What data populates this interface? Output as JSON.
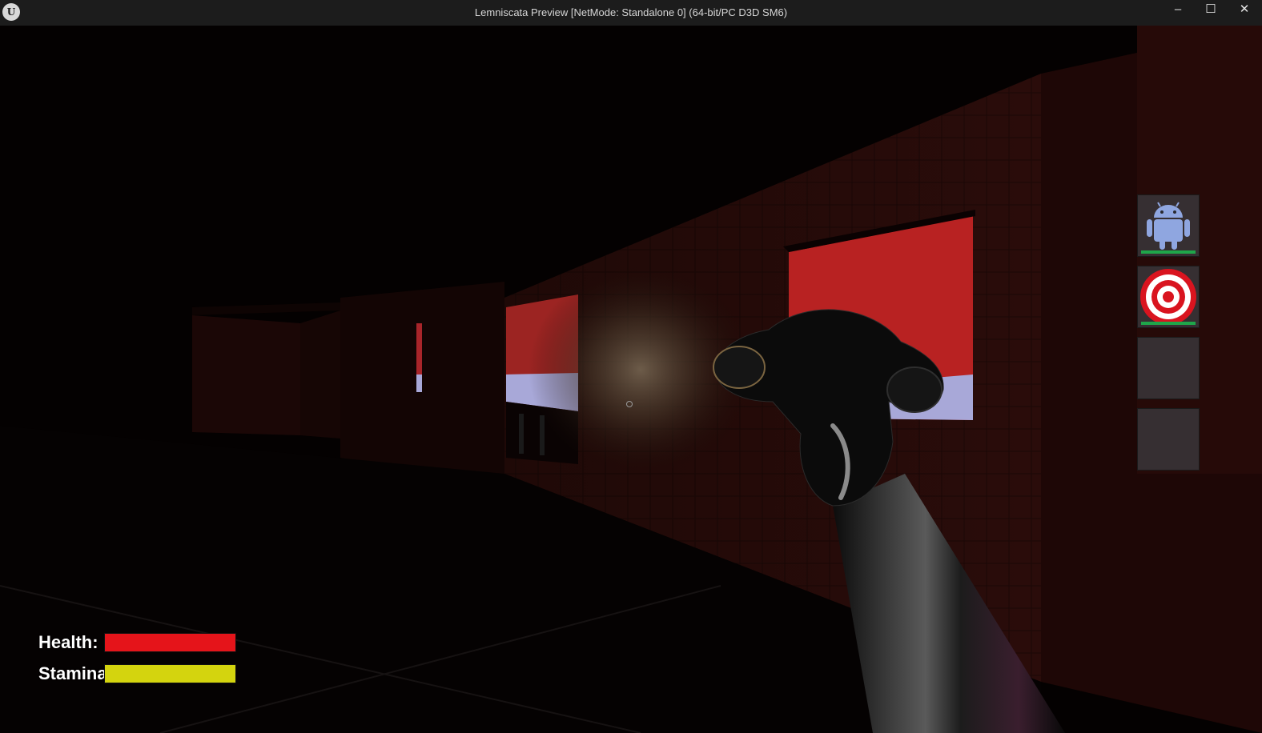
{
  "window": {
    "title": "Lemniscata Preview [NetMode: Standalone 0]  (64-bit/PC D3D SM6)",
    "logo_icon": "unreal-engine-logo-icon",
    "logo_glyph": "U",
    "minimize_glyph": "–",
    "maximize_glyph": "☐",
    "close_glyph": "✕"
  },
  "hud": {
    "health_label": "Health:",
    "health_level": 1.0,
    "health_color": "#e5141a",
    "stamina_label": "Stamina:",
    "stamina_level": 1.0,
    "stamina_color": "#d4d40e"
  },
  "crosshair": {
    "icon": "crosshair-circle-icon"
  },
  "inventory": {
    "slots": [
      {
        "icon": "android-robot-icon",
        "durability": 1.0
      },
      {
        "icon": "target-bullseye-icon",
        "durability": 1.0
      },
      {
        "icon": "",
        "durability": null
      },
      {
        "icon": "",
        "durability": null
      }
    ],
    "durability_color": "#1fa64a"
  },
  "scene": {
    "description_icons": [
      "flashlight-hand-icon"
    ],
    "accent_red": "#b02020",
    "sky_lavender": "#a8a8d8"
  }
}
